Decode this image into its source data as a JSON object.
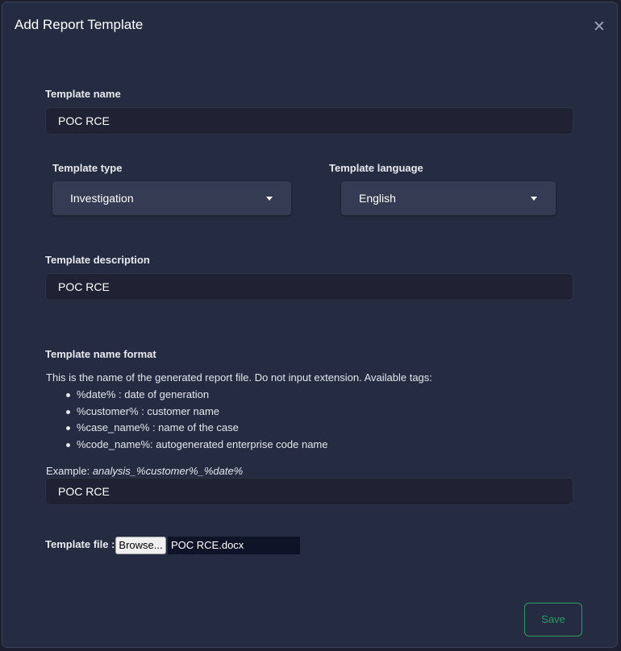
{
  "modal": {
    "title": "Add Report Template",
    "close_icon": "close-icon"
  },
  "form": {
    "template_name": {
      "label": "Template name",
      "value": "POC RCE"
    },
    "template_type": {
      "label": "Template type",
      "selected": "Investigation"
    },
    "template_language": {
      "label": "Template language",
      "selected": "English"
    },
    "template_description": {
      "label": "Template description",
      "value": "POC RCE"
    },
    "name_format": {
      "label": "Template name format",
      "help_text": "This is the name of the generated report file. Do not input extension. Available tags:",
      "tags": [
        "%date% : date of generation",
        "%customer% : customer name",
        "%case_name% : name of the case",
        "%code_name%: autogenerated enterprise code name"
      ],
      "example_prefix": "Example: ",
      "example_value": "analysis_%customer%_%date%",
      "value": "POC RCE"
    },
    "template_file": {
      "label": "Template file :",
      "browse_label": "Browse...",
      "filename": "POC RCE.docx"
    }
  },
  "footer": {
    "save_label": "Save"
  },
  "colors": {
    "modal_bg": "#252c41",
    "input_bg": "#1f2232",
    "select_bg": "#343b52",
    "accent_green": "#2b9a60"
  }
}
